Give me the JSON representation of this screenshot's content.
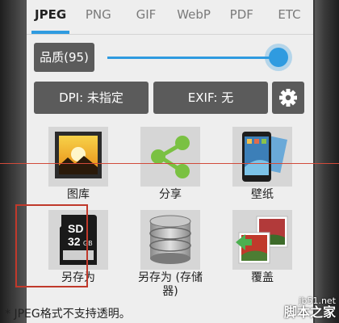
{
  "tabs": [
    {
      "label": "JPEG",
      "active": true
    },
    {
      "label": "PNG",
      "active": false
    },
    {
      "label": "GIF",
      "active": false
    },
    {
      "label": "WebP",
      "active": false
    },
    {
      "label": "PDF",
      "active": false
    },
    {
      "label": "ETC",
      "active": false
    }
  ],
  "quality": {
    "label": "品质(95)",
    "value": 95
  },
  "buttons": {
    "dpi": "DPI: 未指定",
    "exif": "EXIF: 无"
  },
  "grid": [
    {
      "label": "图库",
      "icon": "gallery-icon"
    },
    {
      "label": "分享",
      "icon": "share-icon"
    },
    {
      "label": "壁纸",
      "icon": "wallpaper-icon"
    },
    {
      "label": "另存为",
      "icon": "sd-card-icon",
      "selected": true
    },
    {
      "label": "另存为 (存储\n器)",
      "icon": "storage-icon"
    },
    {
      "label": "覆盖",
      "icon": "overwrite-icon"
    }
  ],
  "sd_card": {
    "line1": "SD",
    "line2": "32",
    "line2_unit": "GB"
  },
  "note": "* JPEG格式不支持透明。",
  "watermark": {
    "site": "jb51.net",
    "name": "脚本之家"
  },
  "colors": {
    "accent": "#2f9be0",
    "button": "#5b5b5b",
    "highlight": "#c0392b"
  }
}
